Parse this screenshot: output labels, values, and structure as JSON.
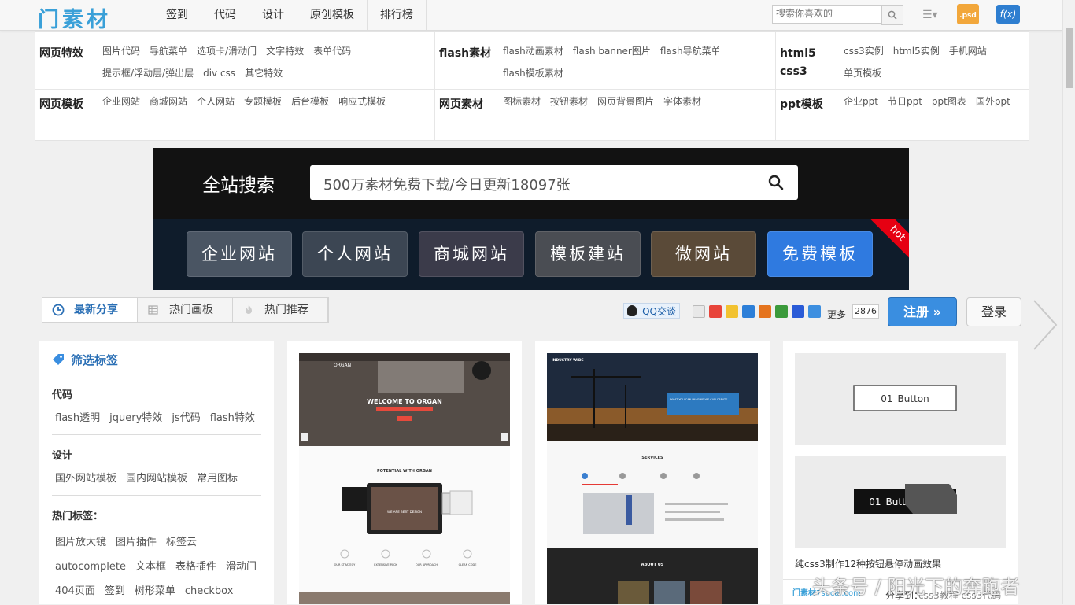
{
  "header": {
    "logo": "门素材",
    "nav": [
      "签到",
      "代码",
      "设计",
      "原创模板",
      "排行榜"
    ],
    "search_placeholder": "搜索你喜欢的",
    "psd_label": ".psd",
    "fx_label": "f(x)"
  },
  "categories": [
    {
      "title": "网页特效",
      "links": [
        "图片代码",
        "导航菜单",
        "选项卡/滑动门",
        "文字特效",
        "表单代码",
        "提示框/浮动层/弹出层",
        "div css",
        "其它特效"
      ]
    },
    {
      "title": "flash素材",
      "links": [
        "flash动画素材",
        "flash banner图片",
        "flash导航菜单",
        "flash模板素材"
      ]
    },
    {
      "title_line1": "html5",
      "title_line2": "css3",
      "links": [
        "css3实例",
        "html5实例",
        "手机网站",
        "单页模板"
      ]
    },
    {
      "title": "网页模板",
      "links": [
        "企业网站",
        "商城网站",
        "个人网站",
        "专题模板",
        "后台模板",
        "响应式模板"
      ]
    },
    {
      "title": "网页素材",
      "links": [
        "图标素材",
        "按钮素材",
        "网页背景图片",
        "字体素材"
      ]
    },
    {
      "title": "ppt模板",
      "links": [
        "企业ppt",
        "节日ppt",
        "ppt图表",
        "国外ppt"
      ]
    }
  ],
  "banner": {
    "title": "全站搜索",
    "search_placeholder": "500万素材免费下载/今日更新18097张",
    "buttons": [
      "企业网站",
      "个人网站",
      "商城网站",
      "模板建站",
      "微网站",
      "免费模板"
    ],
    "hot": "hot"
  },
  "tabs": [
    "最新分享",
    "热门画板",
    "热门推荐"
  ],
  "share": {
    "qq": "QQ交谈",
    "more": "更多",
    "count": "2876"
  },
  "auth": {
    "register": "注册 »",
    "login": "登录"
  },
  "filter": {
    "title": "筛选标签",
    "groups": [
      {
        "name": "代码",
        "tags": [
          "flash透明",
          "jquery特效",
          "js代码",
          "flash特效"
        ]
      },
      {
        "name": "设计",
        "tags": [
          "国外网站模板",
          "国内网站模板",
          "常用图标"
        ]
      },
      {
        "name": "热门标签：",
        "tags": [
          "图片放大镜",
          "图片插件",
          "标签云",
          "autocomplete",
          "文本框",
          "表格插件",
          "滑动门",
          "404页面",
          "签到",
          "树形菜单",
          "checkbox"
        ]
      }
    ]
  },
  "cards": [
    {
      "hero_line1": "ORGAN",
      "hero_line2": "WELCOME TO ORGAN",
      "section": "POTENTIAL WITH ORGAN",
      "design": "WE ARE BEST DESIGN",
      "features": [
        "OUR STRATEGY",
        "EXTENSIVE PACK",
        "OUR APPROACH",
        "CLEAN CODE"
      ]
    },
    {
      "brand": "INDUSTRY WIDE",
      "hero_text": "WHAT YOU CAN IMAGINE WE CAN CREATE.",
      "services": "SERVICES",
      "about": "ABOUT US"
    },
    {
      "button_label": "01_Button",
      "caption": "纯css3制作12种按钮悬停动画效果",
      "footer_share": "分享到：",
      "footer_tags": "css3教程 css3代码",
      "footer_logo": "门素材",
      "footer_site": "7sucai.com"
    }
  ],
  "watermark": "头条号 / 阳光下的奔跑者",
  "colors": {
    "accent": "#2a6fb5",
    "logo": "#3aa0d8",
    "register": "#3a8ee0",
    "hot": "#e60012"
  }
}
